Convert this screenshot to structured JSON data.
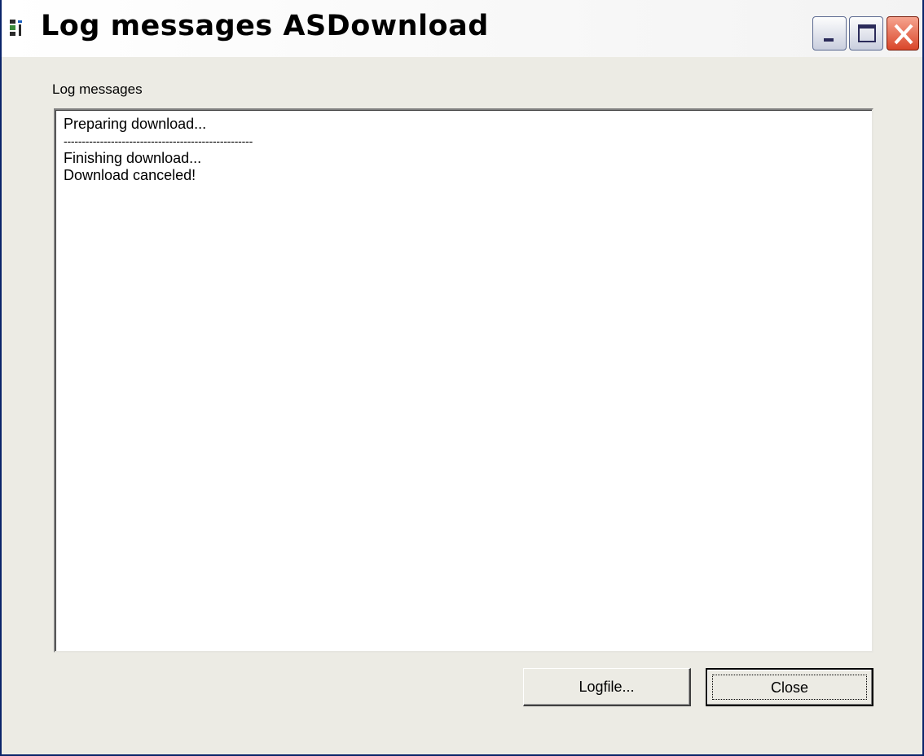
{
  "window": {
    "title": "Log messages ASDownload",
    "minimize_icon": "minimize-icon",
    "maximize_icon": "maximize-icon",
    "close_icon": "close-icon",
    "app_icon": "app-icon"
  },
  "log": {
    "label": "Log messages",
    "lines": [
      "Preparing download...",
      "----------------------------------------------------",
      "Finishing download...",
      "Download canceled!"
    ]
  },
  "buttons": {
    "logfile_label": "Logfile...",
    "close_label": "Close"
  },
  "colors": {
    "dialog_bg": "#ecebe4",
    "close_button": "#d9462a",
    "text": "#000000"
  }
}
